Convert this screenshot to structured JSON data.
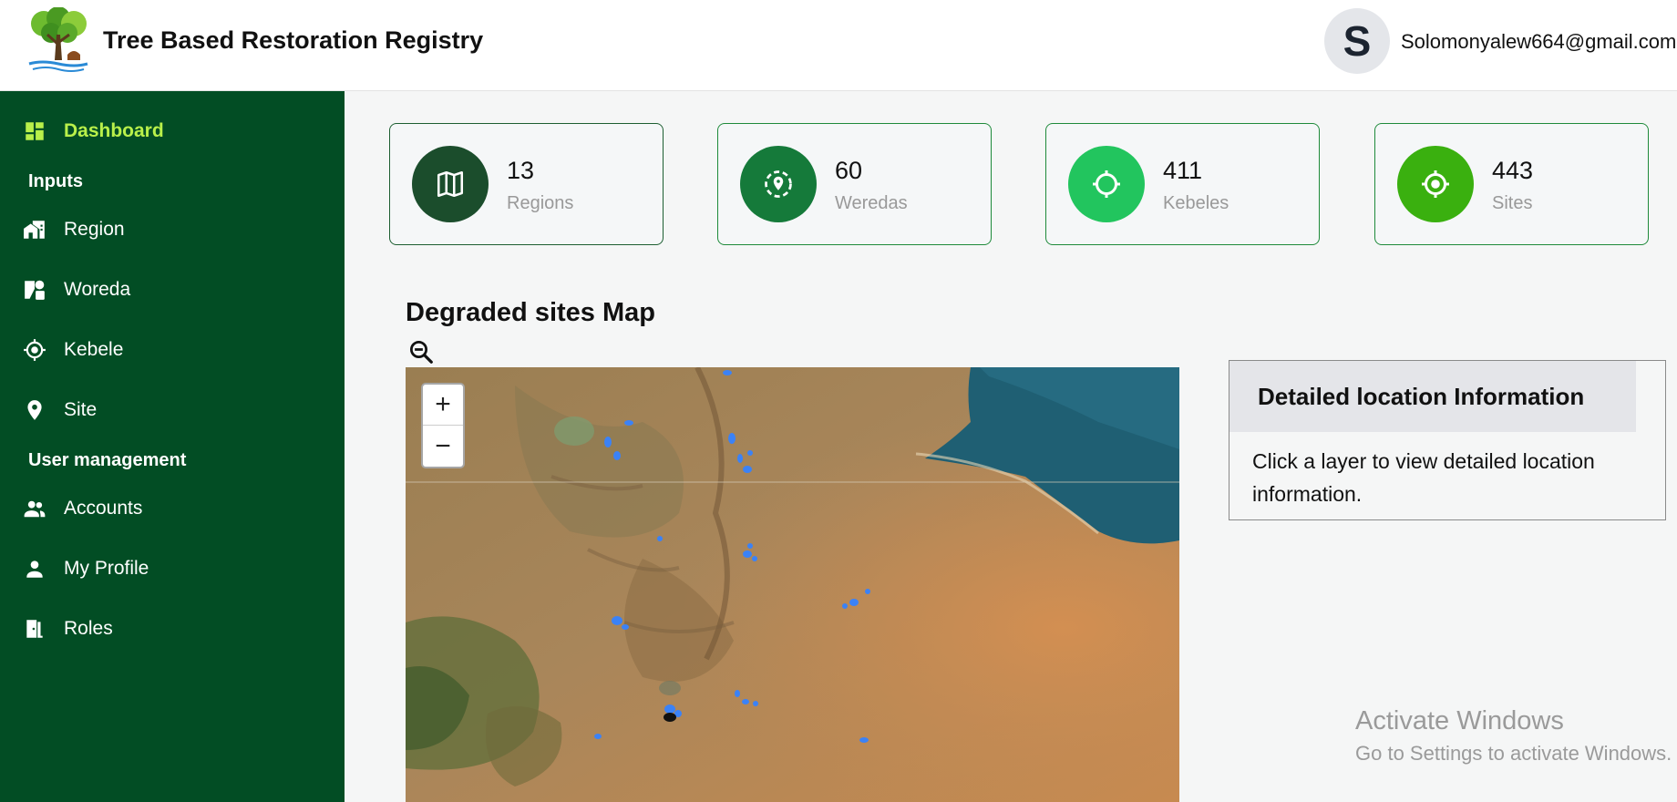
{
  "header": {
    "title": "Tree Based Restoration Registry",
    "avatar_letter": "S",
    "user_email": "Solomonyalew664@gmail.com"
  },
  "sidebar": {
    "dashboard": "Dashboard",
    "inputs_section": "Inputs",
    "region": "Region",
    "woreda": "Woreda",
    "kebele": "Kebele",
    "site": "Site",
    "user_section": "User management",
    "accounts": "Accounts",
    "my_profile": "My Profile",
    "roles": "Roles"
  },
  "stats": [
    {
      "value": "13",
      "label": "Regions",
      "color": "#1b4d2c",
      "icon": "map-icon"
    },
    {
      "value": "60",
      "label": "Weredas",
      "color": "#157a3a",
      "icon": "location-target-icon"
    },
    {
      "value": "411",
      "label": "Kebeles",
      "color": "#22c55e",
      "icon": "crosshair-icon"
    },
    {
      "value": "443",
      "label": "Sites",
      "color": "#3ab00f",
      "icon": "gps-fixed-icon"
    }
  ],
  "map": {
    "title": "Degraded sites Map",
    "zoom_in": "+",
    "zoom_out": "−"
  },
  "info_panel": {
    "title": "Detailed location Information",
    "body": "Click a layer to view detailed location information."
  },
  "watermark": {
    "title": "Activate Windows",
    "subtitle": "Go to Settings to activate Windows."
  },
  "colors": {
    "sidebar_bg": "#024d24",
    "active_nav": "#b9f04a"
  }
}
